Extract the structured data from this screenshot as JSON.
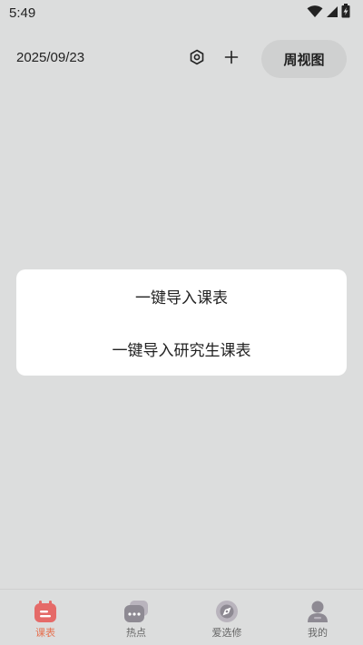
{
  "status_bar": {
    "time": "5:49"
  },
  "header": {
    "date": "2025/09/23",
    "settings_icon": "settings-hexagon-icon",
    "add_icon": "plus-icon",
    "week_view_label": "周视图"
  },
  "popup": {
    "items": [
      {
        "label": "一键导入课表"
      },
      {
        "label": "一键导入研究生课表"
      }
    ]
  },
  "bottom_nav": {
    "items": [
      {
        "label": "课表",
        "icon": "schedule-icon",
        "active": true
      },
      {
        "label": "热点",
        "icon": "chat-bubbles-icon",
        "active": false
      },
      {
        "label": "爱选修",
        "icon": "compass-icon",
        "active": false
      },
      {
        "label": "我的",
        "icon": "profile-icon",
        "active": false
      }
    ]
  },
  "colors": {
    "background": "#dcdddd",
    "card": "#ffffff",
    "accent": "#e6704f",
    "nav_inactive": "#8a8a8a"
  }
}
